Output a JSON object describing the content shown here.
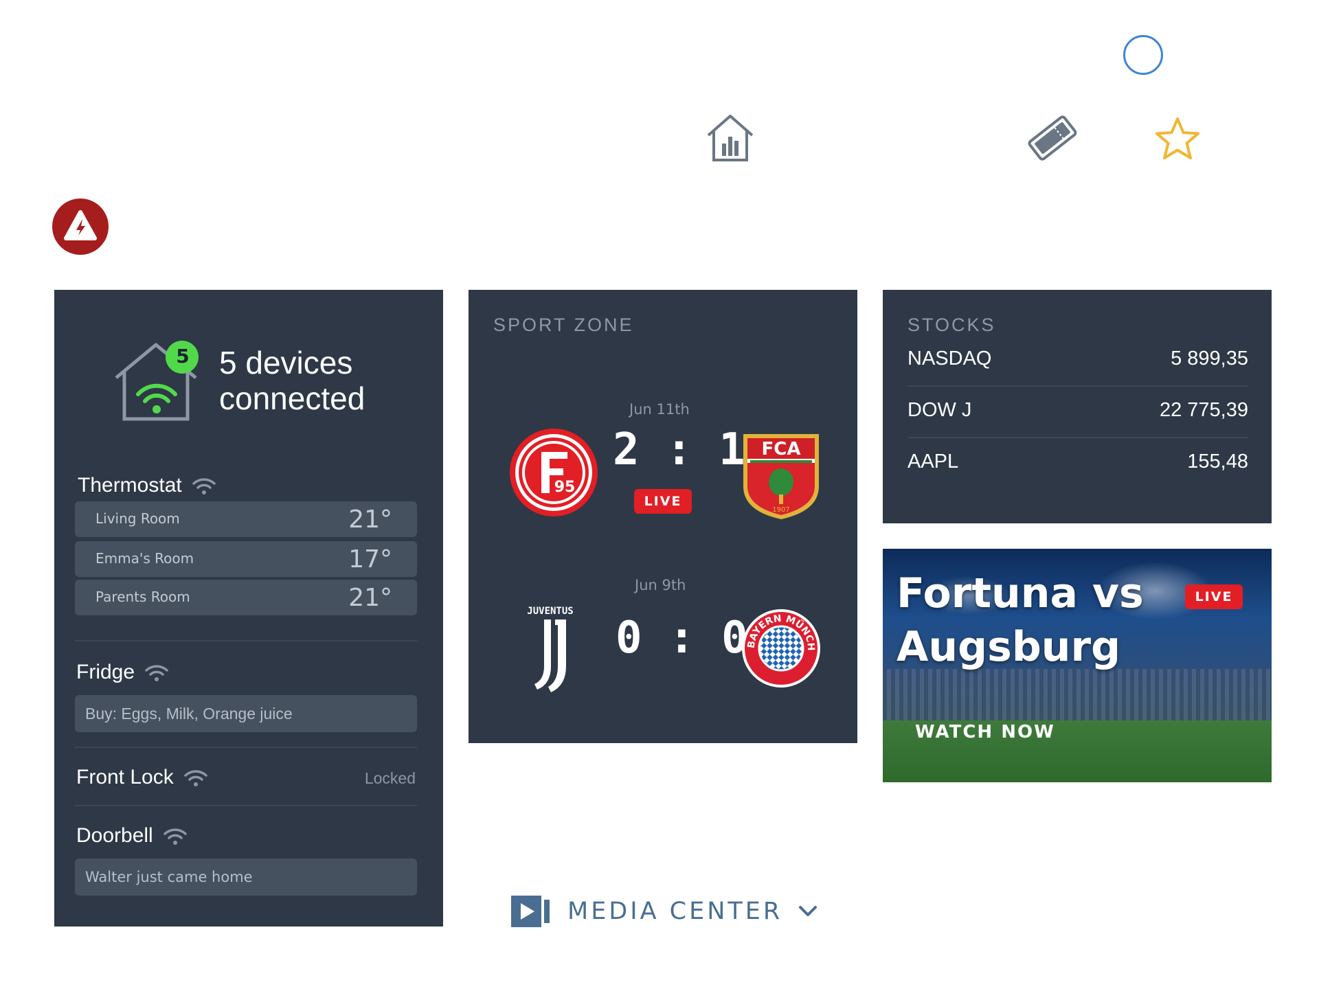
{
  "colors": {
    "panel": "#2e3846",
    "accent_blue": "#3f84d2",
    "live_red": "#e11f25",
    "star": "#f2b632",
    "alert": "#a51d1d",
    "wifi_green": "#52d94b"
  },
  "devices": {
    "count_badge": "5",
    "headline": "5 devices connected",
    "thermostat": {
      "title": "Thermostat",
      "rooms": [
        {
          "name": "Living Room",
          "temp": "21°"
        },
        {
          "name": "Emma's Room",
          "temp": "17°"
        },
        {
          "name": "Parents Room",
          "temp": "21°"
        }
      ]
    },
    "fridge": {
      "title": "Fridge",
      "note": "Buy: Eggs, Milk, Orange juice"
    },
    "front_lock": {
      "title": "Front Lock",
      "status": "Locked"
    },
    "doorbell": {
      "title": "Doorbell",
      "note": "Walter just came home"
    }
  },
  "sport": {
    "heading": "SPORT ZONE",
    "matches": [
      {
        "date": "Jun 11th",
        "score": "2 : 1",
        "live": "LIVE",
        "home_badge": "95",
        "away_badge": "FCA",
        "away_year": "1907"
      },
      {
        "date": "Jun 9th",
        "score": "0 : 0",
        "home_badge": "JUVENTUS",
        "away_badge": "FC BAYERN MÜNCHEN"
      }
    ]
  },
  "stocks": {
    "heading": "STOCKS",
    "rows": [
      {
        "name": "NASDAQ",
        "value": "5 899,35"
      },
      {
        "name": "DOW J",
        "value": "22 775,39"
      },
      {
        "name": "AAPL",
        "value": "155,48"
      }
    ]
  },
  "promo": {
    "title": "Fortuna vs Augsburg",
    "live": "LIVE",
    "cta": "WATCH NOW"
  },
  "media": {
    "label": "MEDIA CENTER"
  }
}
